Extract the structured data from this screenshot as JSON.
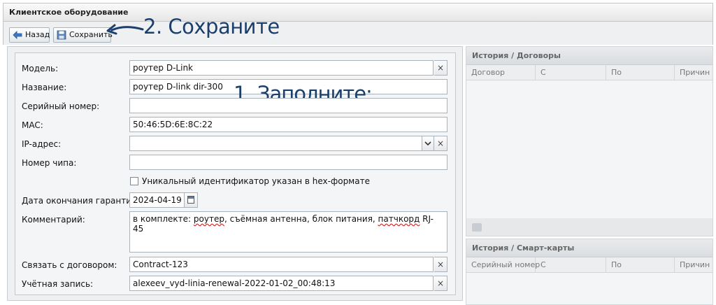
{
  "window": {
    "title": "Клиентское оборудование"
  },
  "toolbar": {
    "back_label": "Назад",
    "save_label": "Сохранить"
  },
  "annotations": {
    "step2": "2. Сохраните",
    "step1": "1. Заполните:"
  },
  "form": {
    "model": {
      "label": "Модель:",
      "value": "роутер D-Link"
    },
    "name": {
      "label": "Название:",
      "value": "роутер D-link dir-300"
    },
    "serial": {
      "label": "Серийный номер:",
      "value": ""
    },
    "mac": {
      "label": "MAC:",
      "value": "50:46:5D:6E:8C:22"
    },
    "ip": {
      "label": "IP-адрес:",
      "value": ""
    },
    "chip": {
      "label": "Номер чипа:",
      "value": ""
    },
    "hex_checkbox": {
      "label": "Уникальный идентификатор указан в hex-формате",
      "checked": false
    },
    "warranty": {
      "label": "Дата окончания гарантии:",
      "value": "2024-04-19"
    },
    "comment": {
      "label": "Комментарий:",
      "prefix": "в комплекте: ",
      "w1": "роутер",
      "mid": ", съёмная антенна, блок питания, ",
      "w2": "патчкорд",
      "suffix": " RJ-45"
    },
    "contract": {
      "label": "Связать с договором:",
      "value": "Contract-123"
    },
    "account": {
      "label": "Учётная запись:",
      "value": "alexeev_vyd-linia-renewal-2022-01-02_00:48:13"
    }
  },
  "history_contracts": {
    "title": "История / Договоры",
    "columns": [
      "Договор",
      "С",
      "По",
      "Причин"
    ]
  },
  "history_cards": {
    "title": "История / Смарт-карты",
    "columns": [
      "Серийный номер",
      "С",
      "По",
      "Причин"
    ]
  },
  "icons": {
    "clear": "×",
    "dropdown": "⌄"
  },
  "colors": {
    "annotation": "#1b3f6c",
    "panel_bg": "#eef0f2"
  }
}
